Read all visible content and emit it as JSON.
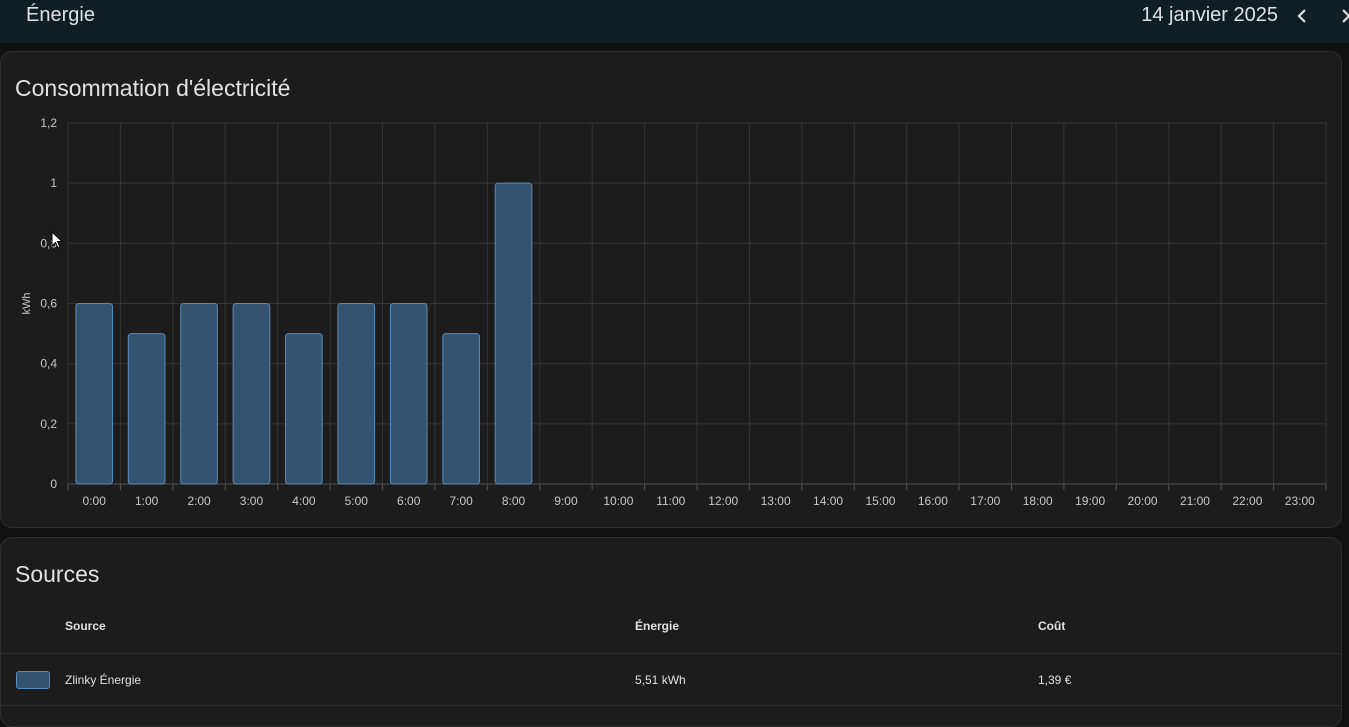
{
  "header": {
    "title": "Énergie",
    "date": "14 janvier 2025",
    "prev_icon": "chevron-left-icon",
    "close_icon": "close-icon"
  },
  "consumption_card": {
    "title": "Consommation d'électricité"
  },
  "chart_data": {
    "type": "bar",
    "ylabel": "kWh",
    "xlabel": "",
    "ylim": [
      0,
      1.2
    ],
    "yticks": [
      "0",
      "0,2",
      "0,4",
      "0,6",
      "0,8",
      "1",
      "1,2"
    ],
    "categories": [
      "0:00",
      "1:00",
      "2:00",
      "3:00",
      "4:00",
      "5:00",
      "6:00",
      "7:00",
      "8:00",
      "9:00",
      "10:00",
      "11:00",
      "12:00",
      "13:00",
      "14:00",
      "15:00",
      "16:00",
      "17:00",
      "18:00",
      "19:00",
      "20:00",
      "21:00",
      "22:00",
      "23:00"
    ],
    "values": [
      0.6,
      0.5,
      0.6,
      0.6,
      0.5,
      0.6,
      0.6,
      0.5,
      1.0,
      null,
      null,
      null,
      null,
      null,
      null,
      null,
      null,
      null,
      null,
      null,
      null,
      null,
      null,
      null
    ],
    "grid": true,
    "bar_fill": "#345370",
    "bar_stroke": "#5a8ab8"
  },
  "sources_card": {
    "title": "Sources",
    "columns": [
      "Source",
      "Énergie",
      "Coût"
    ],
    "rows": [
      {
        "source": "Zlinky Énergie",
        "energy": "5,51 kWh",
        "cost": "1,39 €"
      }
    ]
  }
}
